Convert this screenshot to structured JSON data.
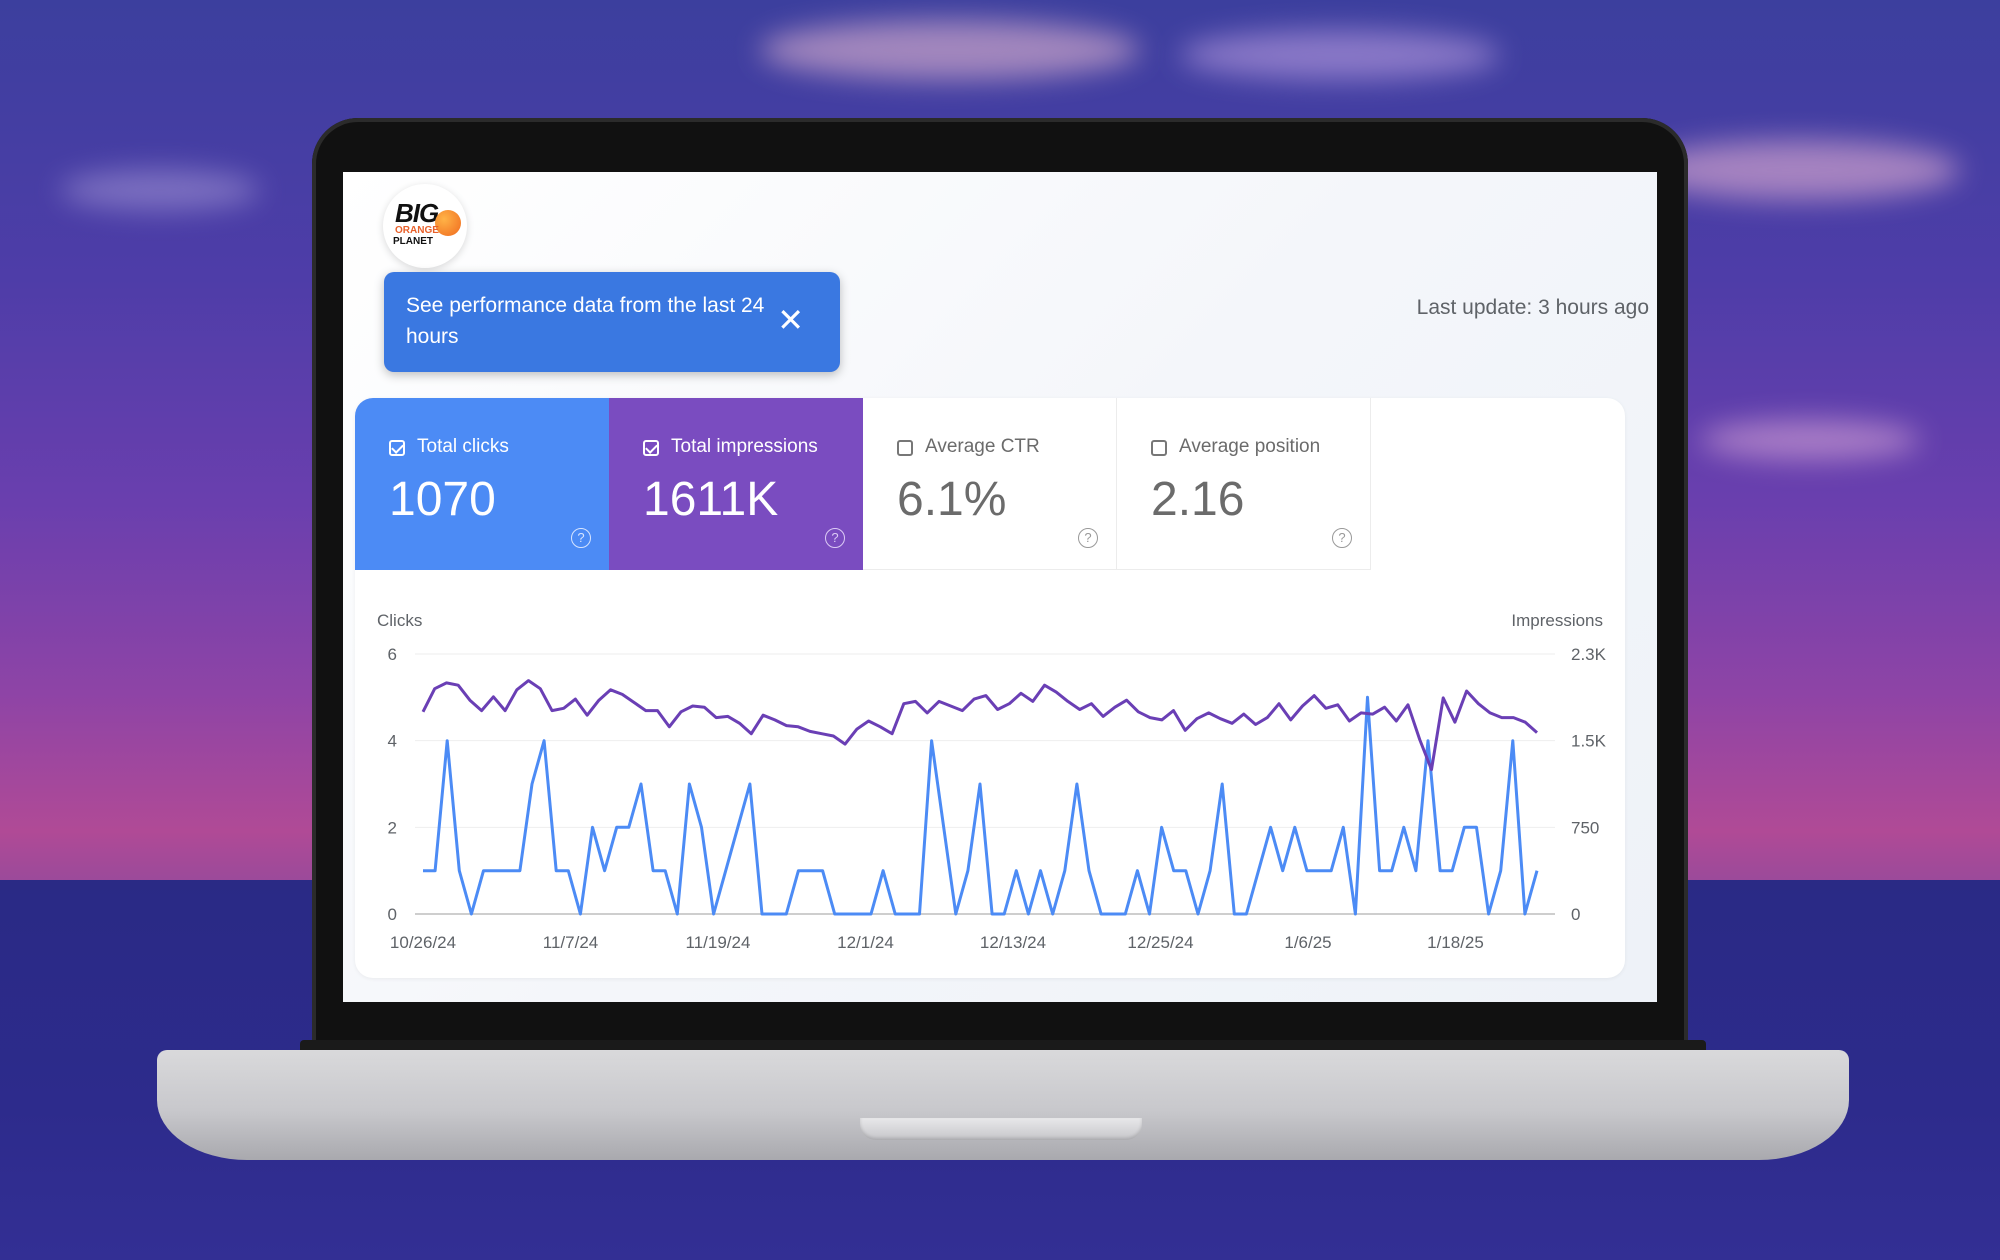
{
  "brand": {
    "logo_line1": "BIG",
    "logo_line2": "ORANGE",
    "logo_line3": "PLANET"
  },
  "banner": {
    "text": "See performance data from the last 24 hours",
    "close_icon": "close-icon"
  },
  "last_update": "Last update: 3 hours ago",
  "metrics": [
    {
      "label": "Total clicks",
      "value": "1070",
      "checked": true,
      "color": "#4c8bf5"
    },
    {
      "label": "Total impressions",
      "value": "1611K",
      "checked": true,
      "color": "#7a4cc0"
    },
    {
      "label": "Average CTR",
      "value": "6.1%",
      "checked": false
    },
    {
      "label": "Average position",
      "value": "2.16",
      "checked": false
    }
  ],
  "help_icon": "help-circle-icon",
  "chart_data": {
    "type": "line",
    "ylabel_left": "Clicks",
    "ylabel_right": "Impressions",
    "y_left_ticks": [
      "0",
      "2",
      "4",
      "6"
    ],
    "y_right_ticks": [
      "0",
      "750",
      "1.5K",
      "2.3K"
    ],
    "ylim_left": [
      0,
      6
    ],
    "ylim_right": [
      0,
      2250
    ],
    "x_tick_labels": [
      "10/26/24",
      "11/7/24",
      "11/19/24",
      "12/1/24",
      "12/13/24",
      "12/25/24",
      "1/6/25",
      "1/18/25"
    ],
    "grid": true,
    "series": [
      {
        "name": "Clicks",
        "axis": "left",
        "color": "#4c8bf5",
        "values": [
          1,
          1,
          4,
          1,
          0,
          1,
          1,
          1,
          1,
          3,
          4,
          1,
          1,
          0,
          2,
          1,
          2,
          2,
          3,
          1,
          1,
          0,
          3,
          2,
          0,
          1,
          2,
          3,
          0,
          0,
          0,
          1,
          1,
          1,
          0,
          0,
          0,
          0,
          1,
          0,
          0,
          0,
          4,
          2,
          0,
          1,
          3,
          0,
          0,
          1,
          0,
          1,
          0,
          1,
          3,
          1,
          0,
          0,
          0,
          1,
          0,
          2,
          1,
          1,
          0,
          1,
          3,
          0,
          0,
          1,
          2,
          1,
          2,
          1,
          1,
          1,
          2,
          0,
          5,
          1,
          1,
          2,
          1,
          4,
          1,
          1,
          2,
          2,
          0,
          1,
          4,
          0,
          1
        ]
      },
      {
        "name": "Impressions",
        "axis": "right",
        "color": "#6a3fb5",
        "values": [
          1750,
          1950,
          2000,
          1980,
          1850,
          1760,
          1880,
          1760,
          1940,
          2020,
          1950,
          1760,
          1780,
          1860,
          1720,
          1850,
          1940,
          1900,
          1830,
          1760,
          1760,
          1620,
          1750,
          1800,
          1790,
          1700,
          1710,
          1650,
          1560,
          1720,
          1680,
          1630,
          1620,
          1580,
          1560,
          1540,
          1470,
          1600,
          1670,
          1620,
          1560,
          1820,
          1840,
          1740,
          1840,
          1800,
          1760,
          1860,
          1890,
          1770,
          1820,
          1910,
          1840,
          1980,
          1920,
          1840,
          1770,
          1820,
          1710,
          1790,
          1850,
          1750,
          1700,
          1680,
          1760,
          1590,
          1690,
          1740,
          1690,
          1650,
          1730,
          1640,
          1700,
          1820,
          1680,
          1800,
          1890,
          1780,
          1810,
          1670,
          1740,
          1730,
          1790,
          1670,
          1810,
          1510,
          1250,
          1870,
          1660,
          1930,
          1820,
          1740,
          1700,
          1700,
          1660,
          1570
        ]
      }
    ]
  }
}
